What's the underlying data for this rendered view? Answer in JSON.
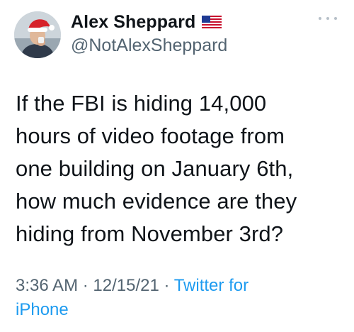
{
  "author": {
    "display_name": "Alex Sheppard",
    "handle": "@NotAlexSheppard",
    "badge_icon": "us-flag-icon",
    "avatar_icon": "santa-hat-avatar"
  },
  "more_icon": "more-dots-icon",
  "tweet": {
    "lines": [
      "If the FBI is hiding 14,000",
      "hours of video footage from",
      "one building on January 6th,",
      "how much evidence are they",
      "hiding from November 3rd?"
    ]
  },
  "meta": {
    "time": "3:36 AM",
    "sep1": " · ",
    "date": "12/15/21",
    "sep2": " · ",
    "source_part1": "Twitter for",
    "source_part2": "iPhone"
  },
  "colors": {
    "link": "#1d9bf0",
    "secondary": "#536471",
    "text": "#0f1419"
  }
}
